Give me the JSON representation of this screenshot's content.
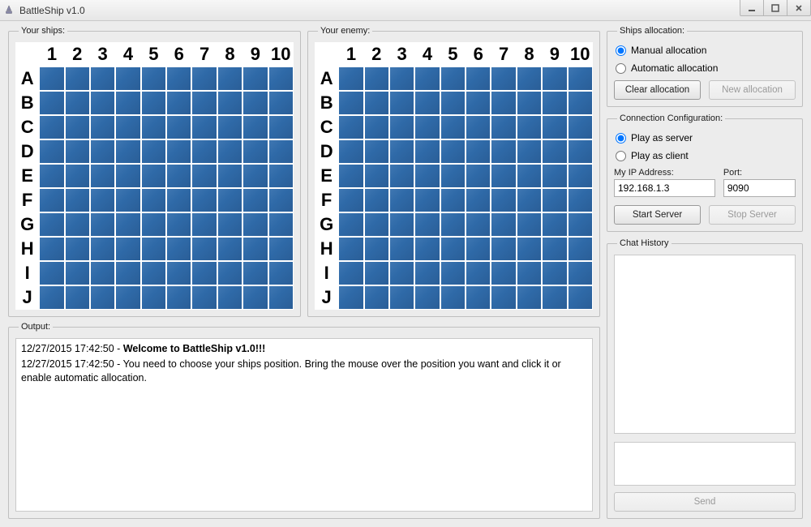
{
  "window": {
    "title": "BattleShip v1.0"
  },
  "boards": {
    "your_ships_legend": "Your ships:",
    "your_enemy_legend": "Your enemy:",
    "cols": [
      "1",
      "2",
      "3",
      "4",
      "5",
      "6",
      "7",
      "8",
      "9",
      "10"
    ],
    "rows": [
      "A",
      "B",
      "C",
      "D",
      "E",
      "F",
      "G",
      "H",
      "I",
      "J"
    ]
  },
  "output": {
    "legend": "Output:",
    "lines": [
      {
        "ts": "12/27/2015 17:42:50",
        "text": "Welcome to BattleShip v1.0!!!",
        "bold": true
      },
      {
        "ts": "12/27/2015 17:42:50",
        "text": "You need to choose your ships position. Bring the mouse over the position you want and click it or enable automatic allocation.",
        "bold": false
      }
    ]
  },
  "ships_alloc": {
    "legend": "Ships allocation:",
    "manual_label": "Manual allocation",
    "automatic_label": "Automatic allocation",
    "selected": "manual",
    "clear_btn": "Clear allocation",
    "new_btn": "New allocation",
    "new_enabled": false
  },
  "connection": {
    "legend": "Connection Configuration:",
    "server_label": "Play as server",
    "client_label": "Play as client",
    "selected": "server",
    "ip_label": "My IP Address:",
    "ip_value": "192.168.1.3",
    "port_label": "Port:",
    "port_value": "9090",
    "start_btn": "Start Server",
    "stop_btn": "Stop Server",
    "stop_enabled": false
  },
  "chat": {
    "legend": "Chat History",
    "send_btn": "Send",
    "send_enabled": false
  },
  "colors": {
    "tile": "#2f6aa8"
  }
}
